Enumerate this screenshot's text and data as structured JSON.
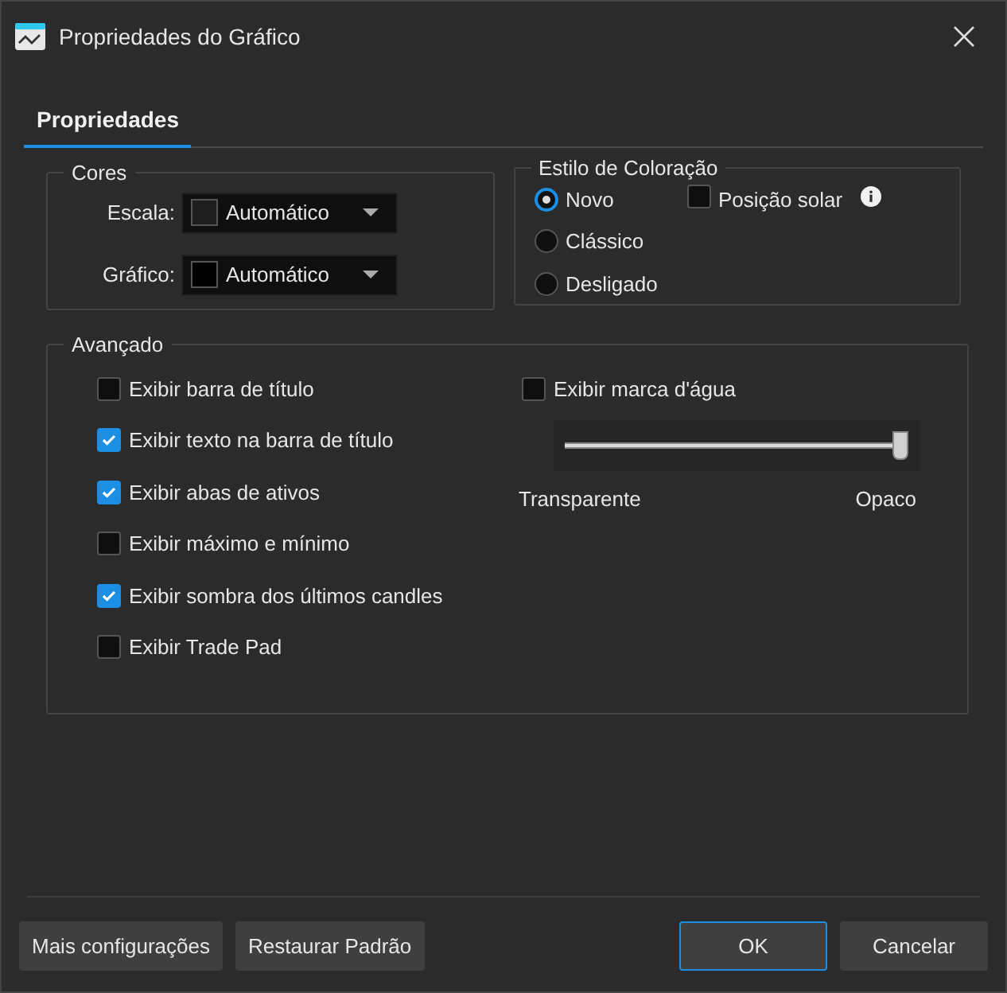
{
  "window": {
    "title": "Propriedades do Gráfico"
  },
  "tabs": [
    {
      "label": "Propriedades",
      "selected": true
    }
  ],
  "cores": {
    "title": "Cores",
    "rows": [
      {
        "label": "Escala:",
        "color": "#1e1e1e",
        "value": "Automático"
      },
      {
        "label": "Gráfico:",
        "color": "#000000",
        "value": "Automático"
      }
    ]
  },
  "estilo": {
    "title": "Estilo de Coloração",
    "options": [
      {
        "label": "Novo",
        "selected": true
      },
      {
        "label": "Clássico",
        "selected": false
      },
      {
        "label": "Desligado",
        "selected": false
      }
    ],
    "posicao_solar": {
      "label": "Posição solar",
      "checked": false
    }
  },
  "avancado": {
    "title": "Avançado",
    "options": [
      {
        "label": "Exibir barra de título",
        "checked": false
      },
      {
        "label": "Exibir texto na barra de título",
        "checked": true
      },
      {
        "label": "Exibir abas de ativos",
        "checked": true
      },
      {
        "label": "Exibir máximo e mínimo",
        "checked": false
      },
      {
        "label": "Exibir sombra dos últimos candles",
        "checked": true
      },
      {
        "label": "Exibir Trade Pad",
        "checked": false
      }
    ],
    "watermark": {
      "label": "Exibir marca d'água",
      "checked": false,
      "level": 1,
      "min_label": "Transparente",
      "max_label": "Opaco"
    }
  },
  "buttons": [
    {
      "label": "Mais configurações",
      "default": false
    },
    {
      "label": "Restaurar Padrão",
      "default": false
    },
    {
      "label": "OK",
      "default": true
    },
    {
      "label": "Cancelar",
      "default": false
    }
  ]
}
